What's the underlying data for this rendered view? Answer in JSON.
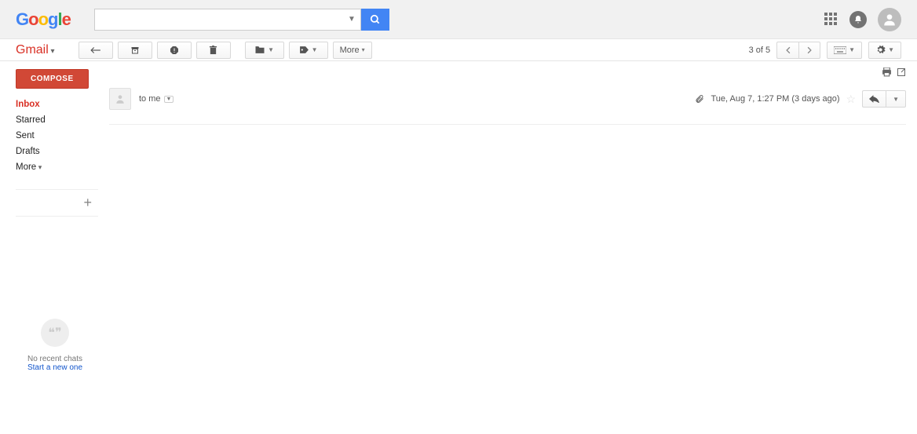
{
  "header": {
    "logo": "Google",
    "search_value": "",
    "search_placeholder": ""
  },
  "topright": {
    "apps": "apps",
    "notifications": "notifications",
    "account": "account"
  },
  "product_label": "Gmail",
  "toolbar": {
    "back": "←",
    "archive": "archive",
    "spam": "spam",
    "delete": "delete",
    "move": "move",
    "labels": "labels",
    "more_label": "More"
  },
  "pagination": {
    "counter": "3 of 5",
    "prev": "prev",
    "next": "next"
  },
  "input_mode": "keyboard",
  "settings": "settings",
  "sidebar": {
    "compose_label": "COMPOSE",
    "items": [
      {
        "label": "Inbox",
        "active": true
      },
      {
        "label": "Starred",
        "active": false
      },
      {
        "label": "Sent",
        "active": false
      },
      {
        "label": "Drafts",
        "active": false
      }
    ],
    "more_label": "More",
    "new_label": "+"
  },
  "chat": {
    "no_recent": "No recent chats",
    "start_new": "Start a new one",
    "icon_glyph": "❝❞"
  },
  "message": {
    "print": "print",
    "popout": "popout",
    "to_line": "to me",
    "timestamp": "Tue, Aug 7, 1:27 PM (3 days ago)",
    "attachment_present": true
  }
}
